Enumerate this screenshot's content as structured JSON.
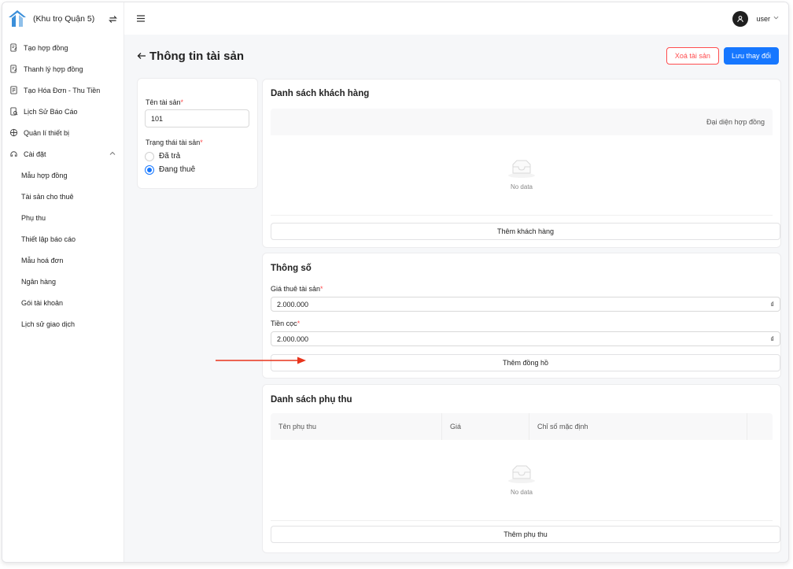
{
  "brand": {
    "name": "(Khu trọ Quận 5)"
  },
  "sidebar": {
    "items": [
      {
        "label": "Tạo hợp đồng",
        "icon": "file-signature-icon"
      },
      {
        "label": "Thanh lý hợp đồng",
        "icon": "file-signature-icon"
      },
      {
        "label": "Tạo Hóa Đơn - Thu Tiền",
        "icon": "receipt-icon"
      },
      {
        "label": "Lịch Sử Báo Cáo",
        "icon": "report-icon"
      },
      {
        "label": "Quản lí thiết bị",
        "icon": "device-icon"
      },
      {
        "label": "Cài đặt",
        "icon": "settings-icon"
      }
    ],
    "subitems": [
      "Mẫu hợp đồng",
      "Tài sản cho thuê",
      "Phụ thu",
      "Thiết lập báo cáo",
      "Mẫu hoá đơn",
      "Ngân hàng",
      "Gói tài khoản",
      "Lịch sử giao dịch"
    ]
  },
  "header": {
    "user": "user"
  },
  "page": {
    "title": "Thông tin tài sản",
    "delete_label": "Xoá tài sản",
    "save_label": "Lưu thay đổi"
  },
  "asset": {
    "name_label": "Tên tài sản",
    "name_value": "101",
    "status_label": "Trạng thái tài sản",
    "status_options": [
      "Đã trả",
      "Đang thuê"
    ],
    "status_selected": "Đang thuê"
  },
  "customers": {
    "title": "Danh sách khách hàng",
    "column": "Đại diện hợp đồng",
    "empty": "No data",
    "add_label": "Thêm khách hàng"
  },
  "specs": {
    "title": "Thông số",
    "price_label": "Giá thuê tài sản",
    "price_value": "2.000.000",
    "deposit_label": "Tiền cọc",
    "deposit_value": "2.000.000",
    "currency": "₫",
    "add_meter_label": "Thêm đồng hồ"
  },
  "surcharges": {
    "title": "Danh sách phụ thu",
    "columns": [
      "Tên phụ thu",
      "Giá",
      "Chỉ số mặc định"
    ],
    "empty": "No data",
    "add_label": "Thêm phụ thu"
  },
  "colors": {
    "primary": "#1677ff",
    "danger": "#ff4d4f",
    "logo": "#3b8fd9",
    "annotation_arrow": "#e8341c"
  }
}
